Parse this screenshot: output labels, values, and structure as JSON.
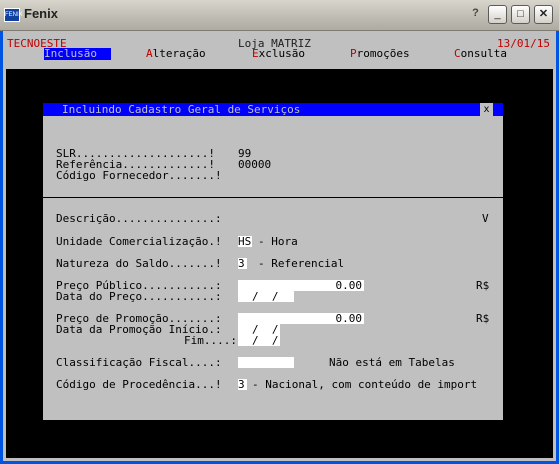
{
  "window": {
    "title": "Fenix",
    "icon": "fenix-app-icon",
    "buttons": {
      "help": "?",
      "minimize": "_",
      "maximize": "□",
      "close": "✕"
    }
  },
  "header": {
    "company": "TECNOESTE",
    "store": "Loja MATRIZ",
    "date": "13/01/15"
  },
  "menu": [
    {
      "hot": "I",
      "rest": "nclusão",
      "selected": true
    },
    {
      "hot": "A",
      "rest": "lteração",
      "selected": false
    },
    {
      "hot": "E",
      "rest": "xclusão",
      "selected": false
    },
    {
      "hot": "P",
      "rest": "romoções",
      "selected": false
    },
    {
      "hot": "C",
      "rest": "onsulta",
      "selected": false
    }
  ],
  "dialog": {
    "title": "Incluindo Cadastro Geral de Serviços",
    "close": "x",
    "slr_label": "SLR....................!",
    "slr_value": "99",
    "referencia_label": "Referência.............!",
    "referencia_value": "00000",
    "fornecedor_label": "Código Fornecedor.......!",
    "descricao_label": "Descrição...............:",
    "descricao_dropdown": "V",
    "unidade_label": "Unidade Comercialização.!",
    "unidade_value": "HS",
    "unidade_desc": "- Hora",
    "natureza_label": "Natureza do Saldo.......!",
    "natureza_value": "3",
    "natureza_desc": "- Referencial",
    "preco_publico_label": "Preço Público...........:",
    "preco_publico_value": "0.00",
    "currency1": "R$",
    "data_preco_label": "Data do Preço...........:",
    "data_preco_value": "/  /",
    "preco_promo_label": "Preço de Promoção.......:",
    "preco_promo_value": "0.00",
    "currency2": "R$",
    "data_promo_inicio_label": "Data da Promoção Início.:",
    "data_promo_inicio_value": "/  /",
    "fim_label": "Fim....:",
    "fim_value": "/  /",
    "classificacao_label": "Classificação Fiscal....:",
    "classificacao_note": "Não está em Tabelas",
    "procedencia_label": "Código de Procedência...!",
    "procedencia_value": "3",
    "procedencia_desc": "- Nacional, com conteúdo de import"
  }
}
